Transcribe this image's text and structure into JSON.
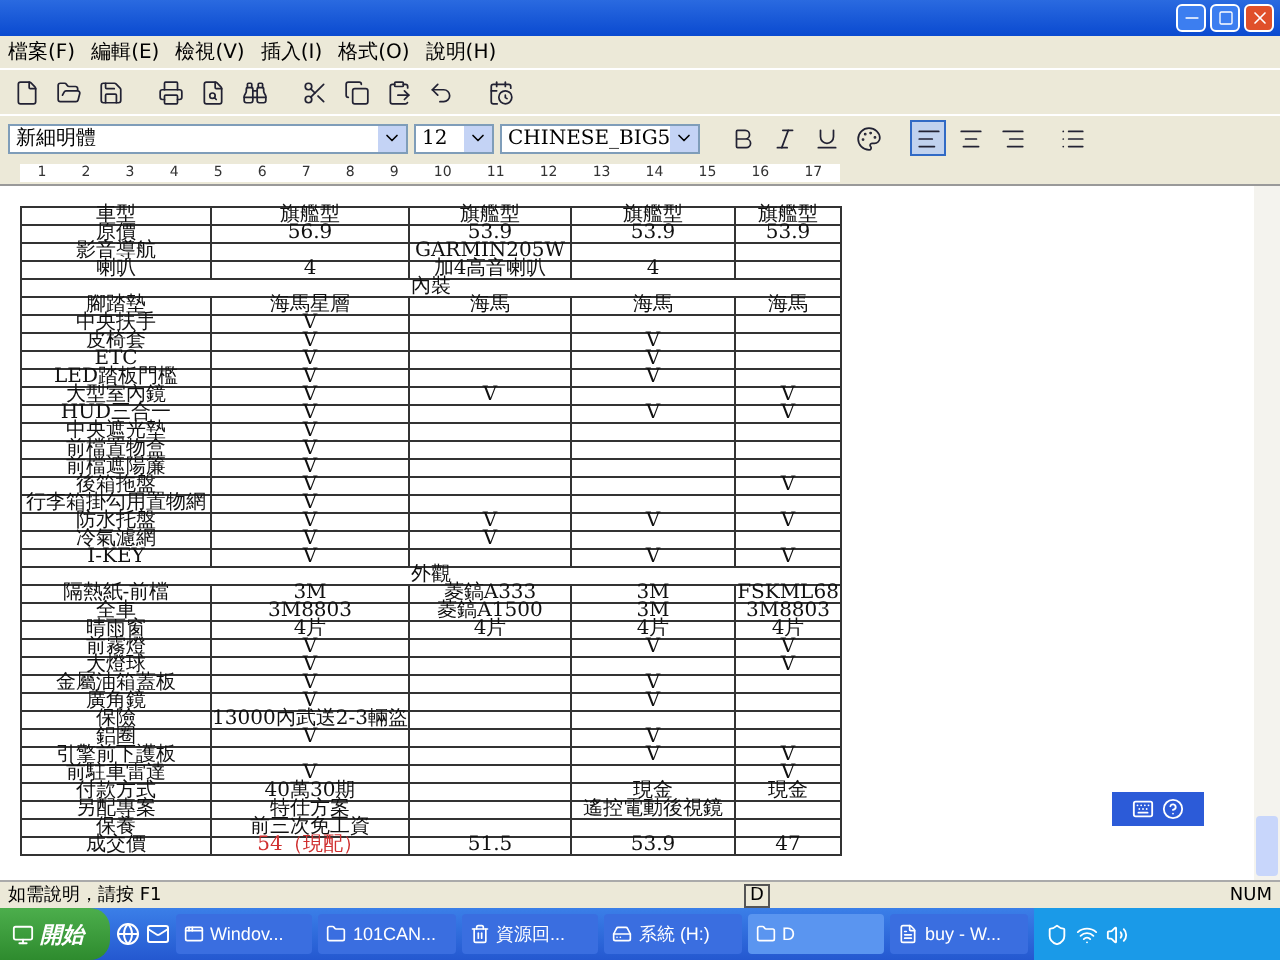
{
  "menu": [
    "檔案(F)",
    "編輯(E)",
    "檢視(V)",
    "插入(I)",
    "格式(O)",
    "說明(H)"
  ],
  "format_bar": {
    "font": "新細明體",
    "size": "12",
    "script": "CHINESE_BIG5",
    "align": [
      {
        "kind": "left",
        "selected": true
      },
      {
        "kind": "center",
        "selected": false
      },
      {
        "kind": "right",
        "selected": false
      }
    ]
  },
  "ruler": [
    "1",
    "2",
    "3",
    "4",
    "5",
    "6",
    "7",
    "8",
    "9",
    "10",
    "11",
    "12",
    "13",
    "14",
    "15",
    "16",
    "17"
  ],
  "table": {
    "rows": [
      {
        "kind": "data",
        "label": "車型",
        "cells": [
          "旗艦型",
          "旗艦型",
          "旗艦型",
          "旗艦型"
        ]
      },
      {
        "kind": "data",
        "label": "原價",
        "cells": [
          "56.9",
          "53.9",
          "53.9",
          "53.9"
        ]
      },
      {
        "kind": "data",
        "label": "影音導航",
        "cells": [
          null,
          "GARMIN205W",
          null,
          null
        ]
      },
      {
        "kind": "data",
        "label": "喇叭",
        "cells": [
          "4",
          "加4高音喇叭",
          "4",
          null
        ]
      },
      {
        "kind": "section",
        "label": "內裝"
      },
      {
        "kind": "data",
        "label": "腳踏墊",
        "cells": [
          "海馬星層",
          "海馬",
          "海馬",
          "海馬"
        ]
      },
      {
        "kind": "data",
        "label": "中央扶手",
        "cells": [
          "V",
          null,
          null,
          null
        ]
      },
      {
        "kind": "data",
        "label": "皮椅套",
        "cells": [
          "V",
          null,
          "V",
          null
        ]
      },
      {
        "kind": "data",
        "label": "ETC",
        "cells": [
          "V",
          null,
          "V",
          null
        ]
      },
      {
        "kind": "data",
        "label": "LED踏板門檻",
        "cells": [
          "V",
          null,
          "V",
          null
        ]
      },
      {
        "kind": "data",
        "label": "大型室內鏡",
        "cells": [
          "V",
          "V",
          null,
          "V"
        ]
      },
      {
        "kind": "data",
        "label": "HUD三合一",
        "cells": [
          "V",
          null,
          "V",
          "V"
        ]
      },
      {
        "kind": "data",
        "label": "中央遮光墊",
        "cells": [
          "V",
          null,
          null,
          null
        ]
      },
      {
        "kind": "data",
        "label": "前檔置物盒",
        "cells": [
          "V",
          null,
          null,
          null
        ]
      },
      {
        "kind": "data",
        "label": "前檔遮陽簾",
        "cells": [
          "V",
          null,
          null,
          null
        ]
      },
      {
        "kind": "data",
        "label": "後箱拖盤",
        "cells": [
          "V",
          null,
          null,
          "V"
        ]
      },
      {
        "kind": "data",
        "label": "行李箱掛勾用置物網",
        "cells": [
          "V",
          null,
          null,
          null
        ]
      },
      {
        "kind": "data",
        "label": "防水托盤",
        "cells": [
          "V",
          "V",
          "V",
          "V"
        ]
      },
      {
        "kind": "data",
        "label": "冷氣濾網",
        "cells": [
          "V",
          "V",
          null,
          null
        ]
      },
      {
        "kind": "data",
        "label": "I-KEY",
        "cells": [
          "V",
          null,
          "V",
          "V"
        ]
      },
      {
        "kind": "section",
        "label": "外觀"
      },
      {
        "kind": "data",
        "label": "隔熱紙-前檔",
        "cells": [
          "3M",
          "菱鎬A333",
          "3M",
          "FSKML68"
        ]
      },
      {
        "kind": "data",
        "label": "全車",
        "cells": [
          "3M8803",
          "菱鎬A1500",
          "3M",
          "3M8803"
        ]
      },
      {
        "kind": "data",
        "label": "晴雨窗",
        "cells": [
          "4片",
          "4片",
          "4片",
          "4片"
        ]
      },
      {
        "kind": "data",
        "label": "前霧燈",
        "cells": [
          "V",
          null,
          "V",
          "V"
        ]
      },
      {
        "kind": "data",
        "label": "大燈球",
        "cells": [
          "V",
          null,
          null,
          "V"
        ]
      },
      {
        "kind": "data",
        "label": "金屬油箱蓋板",
        "cells": [
          "V",
          null,
          "V",
          null
        ]
      },
      {
        "kind": "data",
        "label": "廣角鏡",
        "cells": [
          "V",
          null,
          "V",
          null
        ]
      },
      {
        "kind": "data",
        "label": "保險",
        "cells": [
          "13000內武送2-3輛盜",
          null,
          null,
          null
        ]
      },
      {
        "kind": "data",
        "label": "鋁圈",
        "cells": [
          "V",
          null,
          "V",
          null
        ]
      },
      {
        "kind": "data",
        "label": "引擎前下護板",
        "cells": [
          null,
          null,
          "V",
          "V"
        ]
      },
      {
        "kind": "data",
        "label": "前駐車雷達",
        "cells": [
          "V",
          null,
          null,
          "V"
        ]
      },
      {
        "kind": "data",
        "label": "付款方式",
        "cells": [
          "40萬30期",
          null,
          "現金",
          "現金"
        ]
      },
      {
        "kind": "data",
        "label": "另配專案",
        "cells": [
          "特仕方案",
          null,
          "遙控電動後視鏡",
          null
        ]
      },
      {
        "kind": "data",
        "label": "保養",
        "cells": [
          "前三次免工資",
          null,
          null,
          null
        ]
      },
      {
        "kind": "data",
        "label": "成交價",
        "cells": [
          {
            "text": "54（現配）",
            "color": "#d03030"
          },
          "51.5",
          "53.9",
          "47"
        ]
      }
    ]
  },
  "status_bar": {
    "help": "如需說明，請按 F1",
    "mode": "D",
    "num": "NUM"
  },
  "taskbar": {
    "start": "開始",
    "tasks": [
      {
        "label": "Windov...",
        "kind": "app",
        "selected": false
      },
      {
        "label": "101CAN...",
        "kind": "folder",
        "selected": false
      },
      {
        "label": "資源回...",
        "kind": "recycle",
        "selected": false
      },
      {
        "label": "系統 (H:)",
        "kind": "drive",
        "selected": false
      },
      {
        "label": "D",
        "kind": "folder",
        "selected": true
      },
      {
        "label": "buy - W...",
        "kind": "doc",
        "selected": false
      }
    ]
  }
}
